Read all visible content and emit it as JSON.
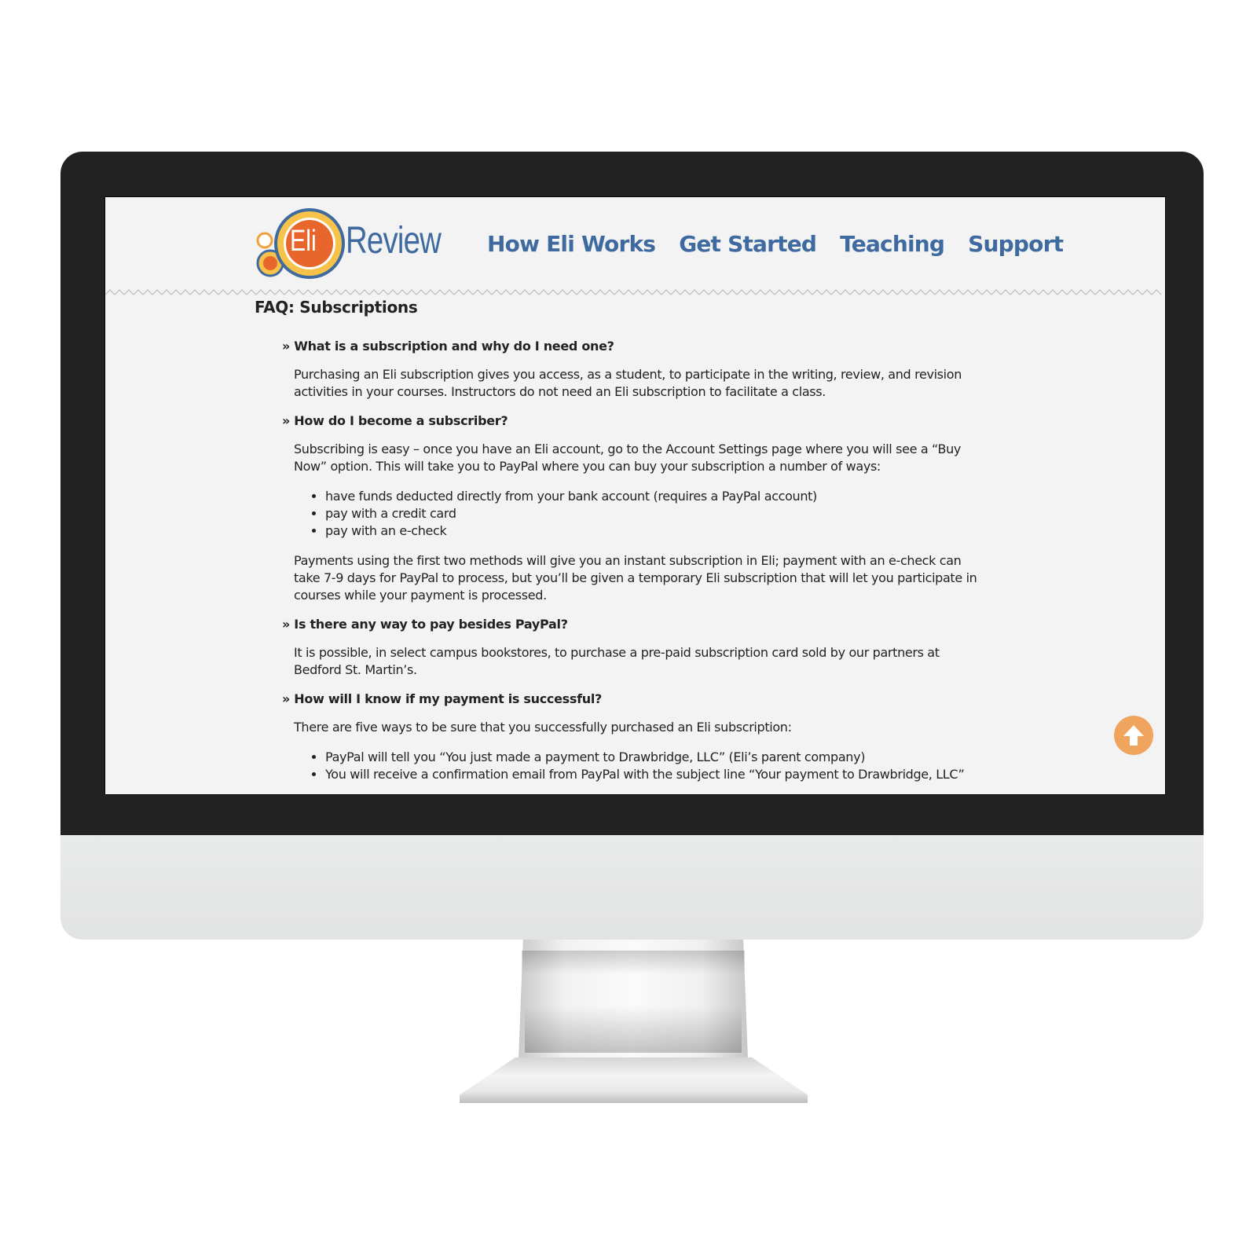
{
  "site": {
    "logo_mark": "Eli",
    "logo_word": "Review",
    "brand_color": "#3f6aa0",
    "accent_color": "#f0a55e"
  },
  "nav": {
    "items": [
      {
        "label": "How Eli Works"
      },
      {
        "label": "Get Started"
      },
      {
        "label": "Teaching"
      },
      {
        "label": "Support"
      }
    ]
  },
  "page": {
    "title": "FAQ: Subscriptions",
    "faq": [
      {
        "question": "» What is a subscription and why do I need one?",
        "paragraphs": [
          "Purchasing an Eli subscription gives you access, as a student, to participate in the writing, review, and revision activities in your courses. Instructors do not need an Eli subscription to facilitate a class."
        ]
      },
      {
        "question": "» How do I become a subscriber?",
        "intro": "Subscribing is easy – once you have an Eli account, go to the Account Settings page where you will see a “Buy Now” option.  This will take you to PayPal where you can buy your subscription a number of ways:",
        "bullets": [
          "have funds deducted directly from your bank account (requires a PayPal account)",
          "pay with a credit card",
          "pay with an e-check"
        ],
        "outro": "Payments using the first two methods will give you an instant subscription in Eli; payment with an e-check can take 7-9 days for PayPal to process, but you’ll be given a temporary Eli subscription that will let you participate in courses while your payment is processed."
      },
      {
        "question": "» Is there any way to pay besides PayPal?",
        "paragraphs": [
          "It is possible, in select campus bookstores, to purchase a pre-paid subscription card sold by our partners at Bedford St. Martin’s."
        ]
      },
      {
        "question": "» How will I know if my payment is successful?",
        "intro": "There are five ways to be sure that you successfully purchased an Eli subscription:",
        "bullets": [
          "PayPal will tell you “You just made a payment to Drawbridge, LLC” (Eli’s parent company)",
          "You will receive a confirmation email from PayPal with the subject line “Your payment to Drawbridge, LLC”"
        ]
      }
    ]
  },
  "scroll_top": {
    "icon": "arrow-up-icon"
  }
}
